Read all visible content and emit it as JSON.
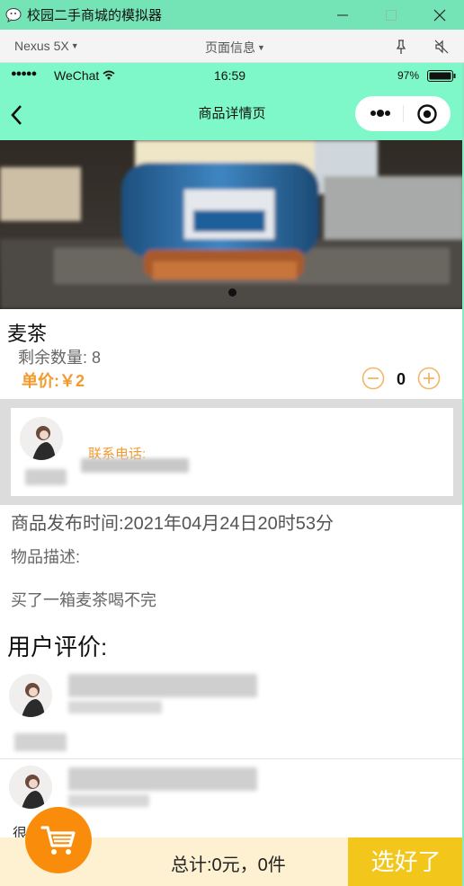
{
  "window": {
    "title": "校园二手商城的模拟器",
    "logo_icon": "wechat-logo-icon"
  },
  "toolbar": {
    "device": "Nexus 5X",
    "page_info": "页面信息"
  },
  "status_bar": {
    "carrier": "WeChat",
    "time": "16:59",
    "battery": "97%"
  },
  "nav": {
    "title": "商品详情页"
  },
  "product": {
    "name": "麦茶",
    "stock_label": "剩余数量:",
    "stock_value": "8",
    "price": "单价:￥2",
    "quantity": "0"
  },
  "seller": {
    "phone_label": "联系电话:"
  },
  "details": {
    "publish_time": "商品发布时间:2021年04月24日20时53分",
    "desc_label": "物品描述:",
    "desc_text": "买了一箱麦茶喝不完"
  },
  "reviews": {
    "title": "用户评价:",
    "partial_text": "很"
  },
  "cart": {
    "total": "总计:0元，0件",
    "checkout_label": "选好了"
  },
  "colors": {
    "accent": "#f29a2e",
    "nav_bg": "#7ef8c8",
    "checkout_bg": "#f3c61c",
    "fab_bg": "#f98d0b"
  }
}
